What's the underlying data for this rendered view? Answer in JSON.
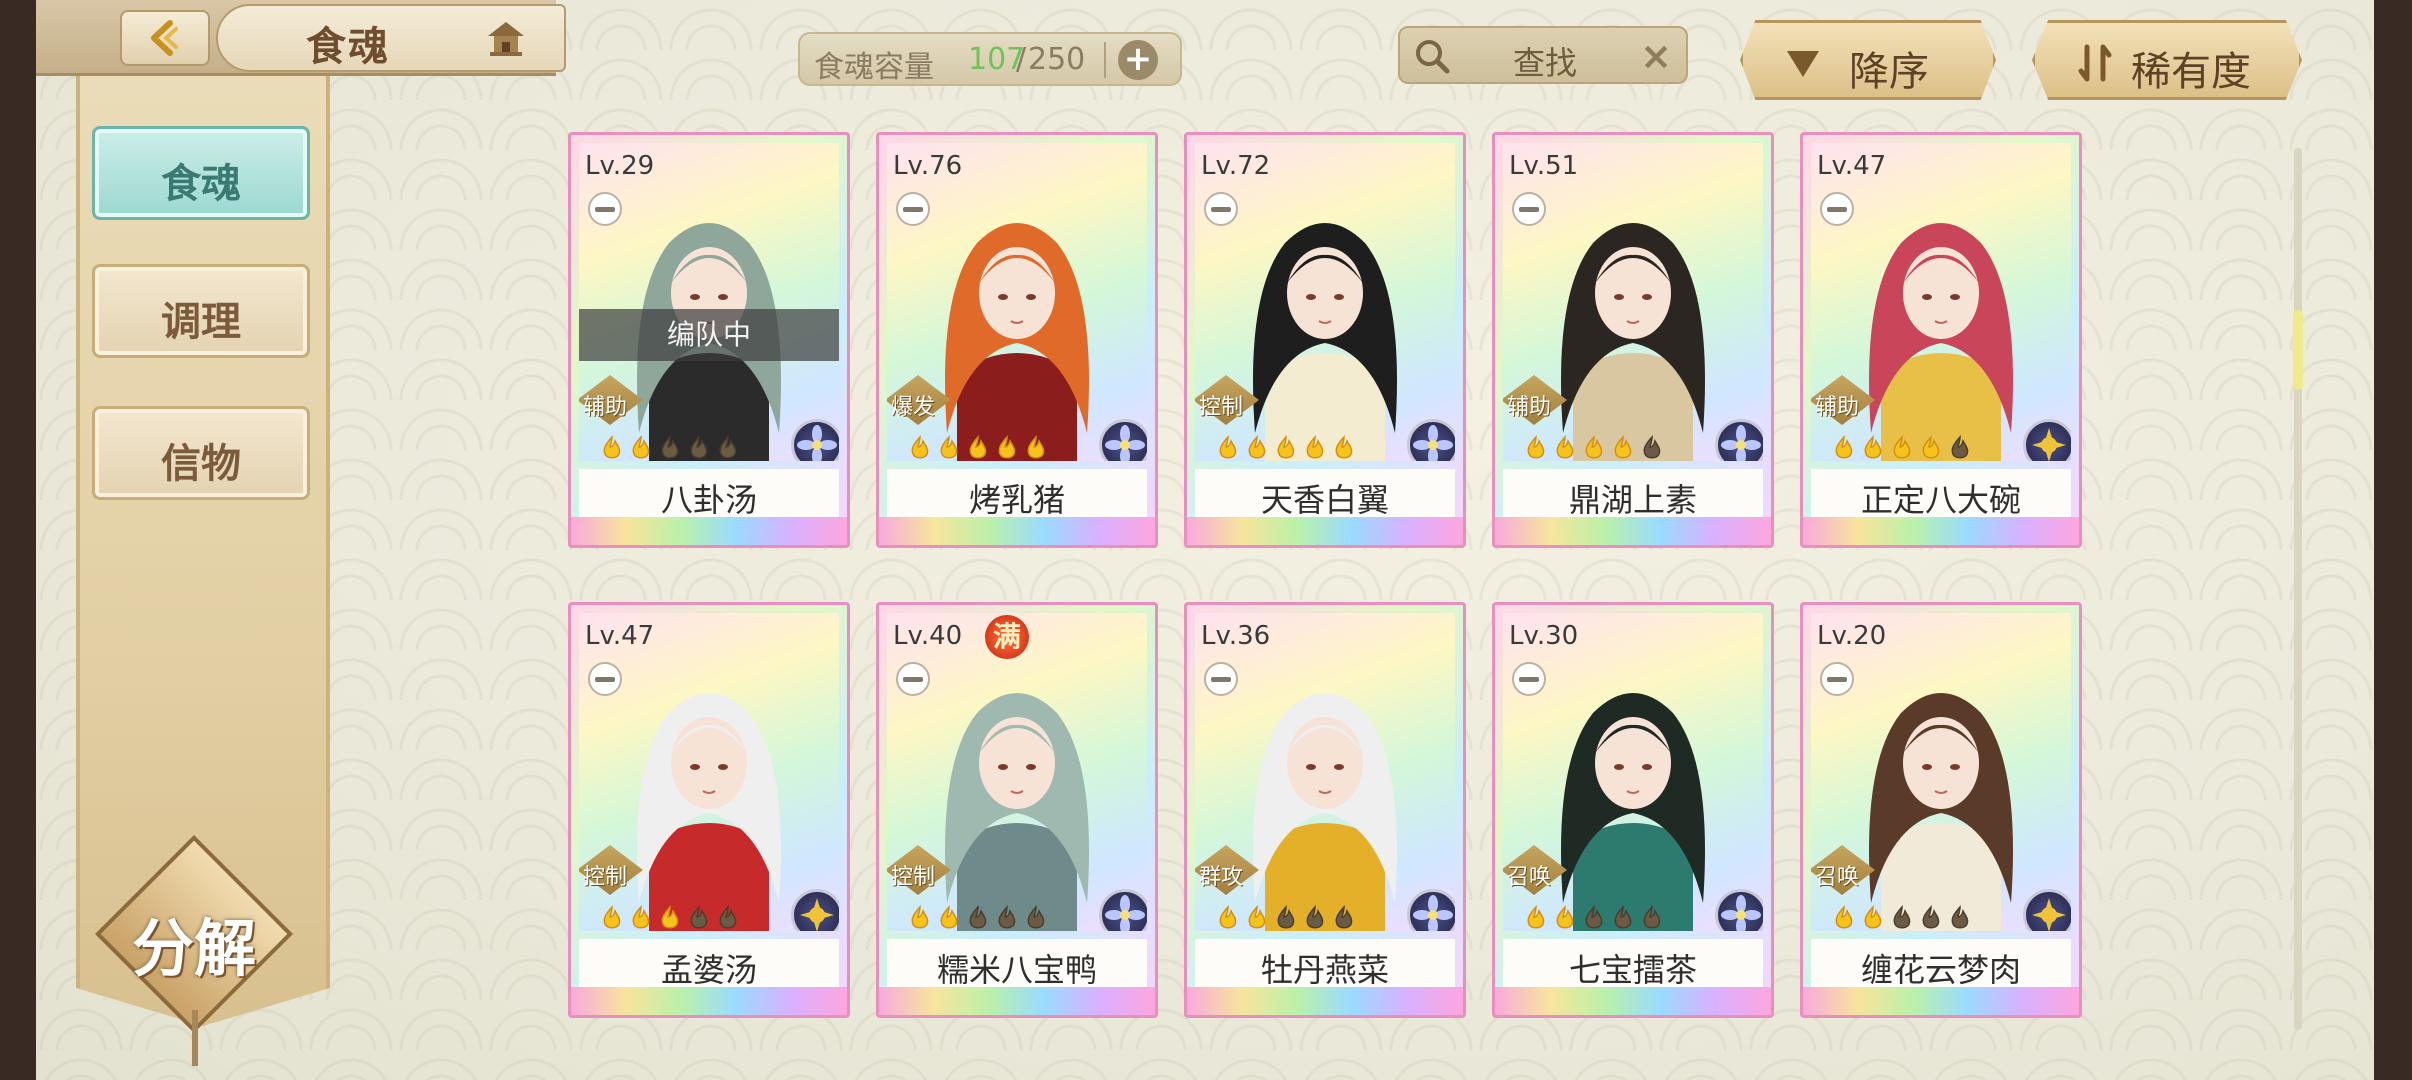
{
  "header": {
    "title": "食魂",
    "capacity": {
      "label": "食魂容量",
      "current": "107",
      "sep": "/",
      "max": "250"
    },
    "search": {
      "text": "查找"
    },
    "sort": {
      "order_label": "降序",
      "rarity_label": "稀有度"
    }
  },
  "sidebar": {
    "tabs": [
      {
        "label": "食魂",
        "active": true
      },
      {
        "label": "调理",
        "active": false
      },
      {
        "label": "信物",
        "active": false
      }
    ],
    "decompose_label": "分解"
  },
  "status": {
    "in_team": "编队中",
    "max": "满"
  },
  "cards": [
    {
      "level": "Lv.29",
      "name": "八卦汤",
      "role": "辅助",
      "stars": 2,
      "element": "lotus",
      "in_team": true,
      "max": false,
      "hair": "#8fa69a",
      "robe": "#2b2b2b"
    },
    {
      "level": "Lv.76",
      "name": "烤乳猪",
      "role": "爆发",
      "stars": 5,
      "element": "lotus",
      "in_team": false,
      "max": false,
      "hair": "#e06a2a",
      "robe": "#8b1d1d"
    },
    {
      "level": "Lv.72",
      "name": "天香白翼",
      "role": "控制",
      "stars": 5,
      "element": "lotus",
      "in_team": false,
      "max": false,
      "hair": "#1e1e1e",
      "robe": "#f3ecd0"
    },
    {
      "level": "Lv.51",
      "name": "鼎湖上素",
      "role": "辅助",
      "stars": 4,
      "element": "lotus",
      "in_team": false,
      "max": false,
      "hair": "#2b2622",
      "robe": "#d8c7a1"
    },
    {
      "level": "Lv.47",
      "name": "正定八大碗",
      "role": "辅助",
      "stars": 4,
      "element": "sun",
      "in_team": false,
      "max": false,
      "hair": "#c9455a",
      "robe": "#e8c048"
    },
    {
      "level": "Lv.47",
      "name": "孟婆汤",
      "role": "控制",
      "stars": 3,
      "element": "sun",
      "in_team": false,
      "max": false,
      "hair": "#f0efef",
      "robe": "#c72a2a"
    },
    {
      "level": "Lv.40",
      "name": "糯米八宝鸭",
      "role": "控制",
      "stars": 2,
      "element": "lotus",
      "in_team": false,
      "max": true,
      "hair": "#9fb8b0",
      "robe": "#6f8a8a"
    },
    {
      "level": "Lv.36",
      "name": "牡丹燕菜",
      "role": "群攻",
      "stars": 2,
      "element": "lotus",
      "in_team": false,
      "max": false,
      "hair": "#efeff0",
      "robe": "#e4b02a"
    },
    {
      "level": "Lv.30",
      "name": "七宝擂茶",
      "role": "召唤",
      "stars": 2,
      "element": "lotus",
      "in_team": false,
      "max": false,
      "hair": "#1f2a24",
      "robe": "#2d7a6f"
    },
    {
      "level": "Lv.20",
      "name": "缠花云梦肉",
      "role": "召唤",
      "stars": 2,
      "element": "sun",
      "in_team": false,
      "max": false,
      "hair": "#5a3a28",
      "robe": "#f1ead8"
    }
  ],
  "colors": {
    "accent_teal": "#9bd8d0",
    "gold": "#b59559",
    "capacity_green": "#6fc35b"
  }
}
